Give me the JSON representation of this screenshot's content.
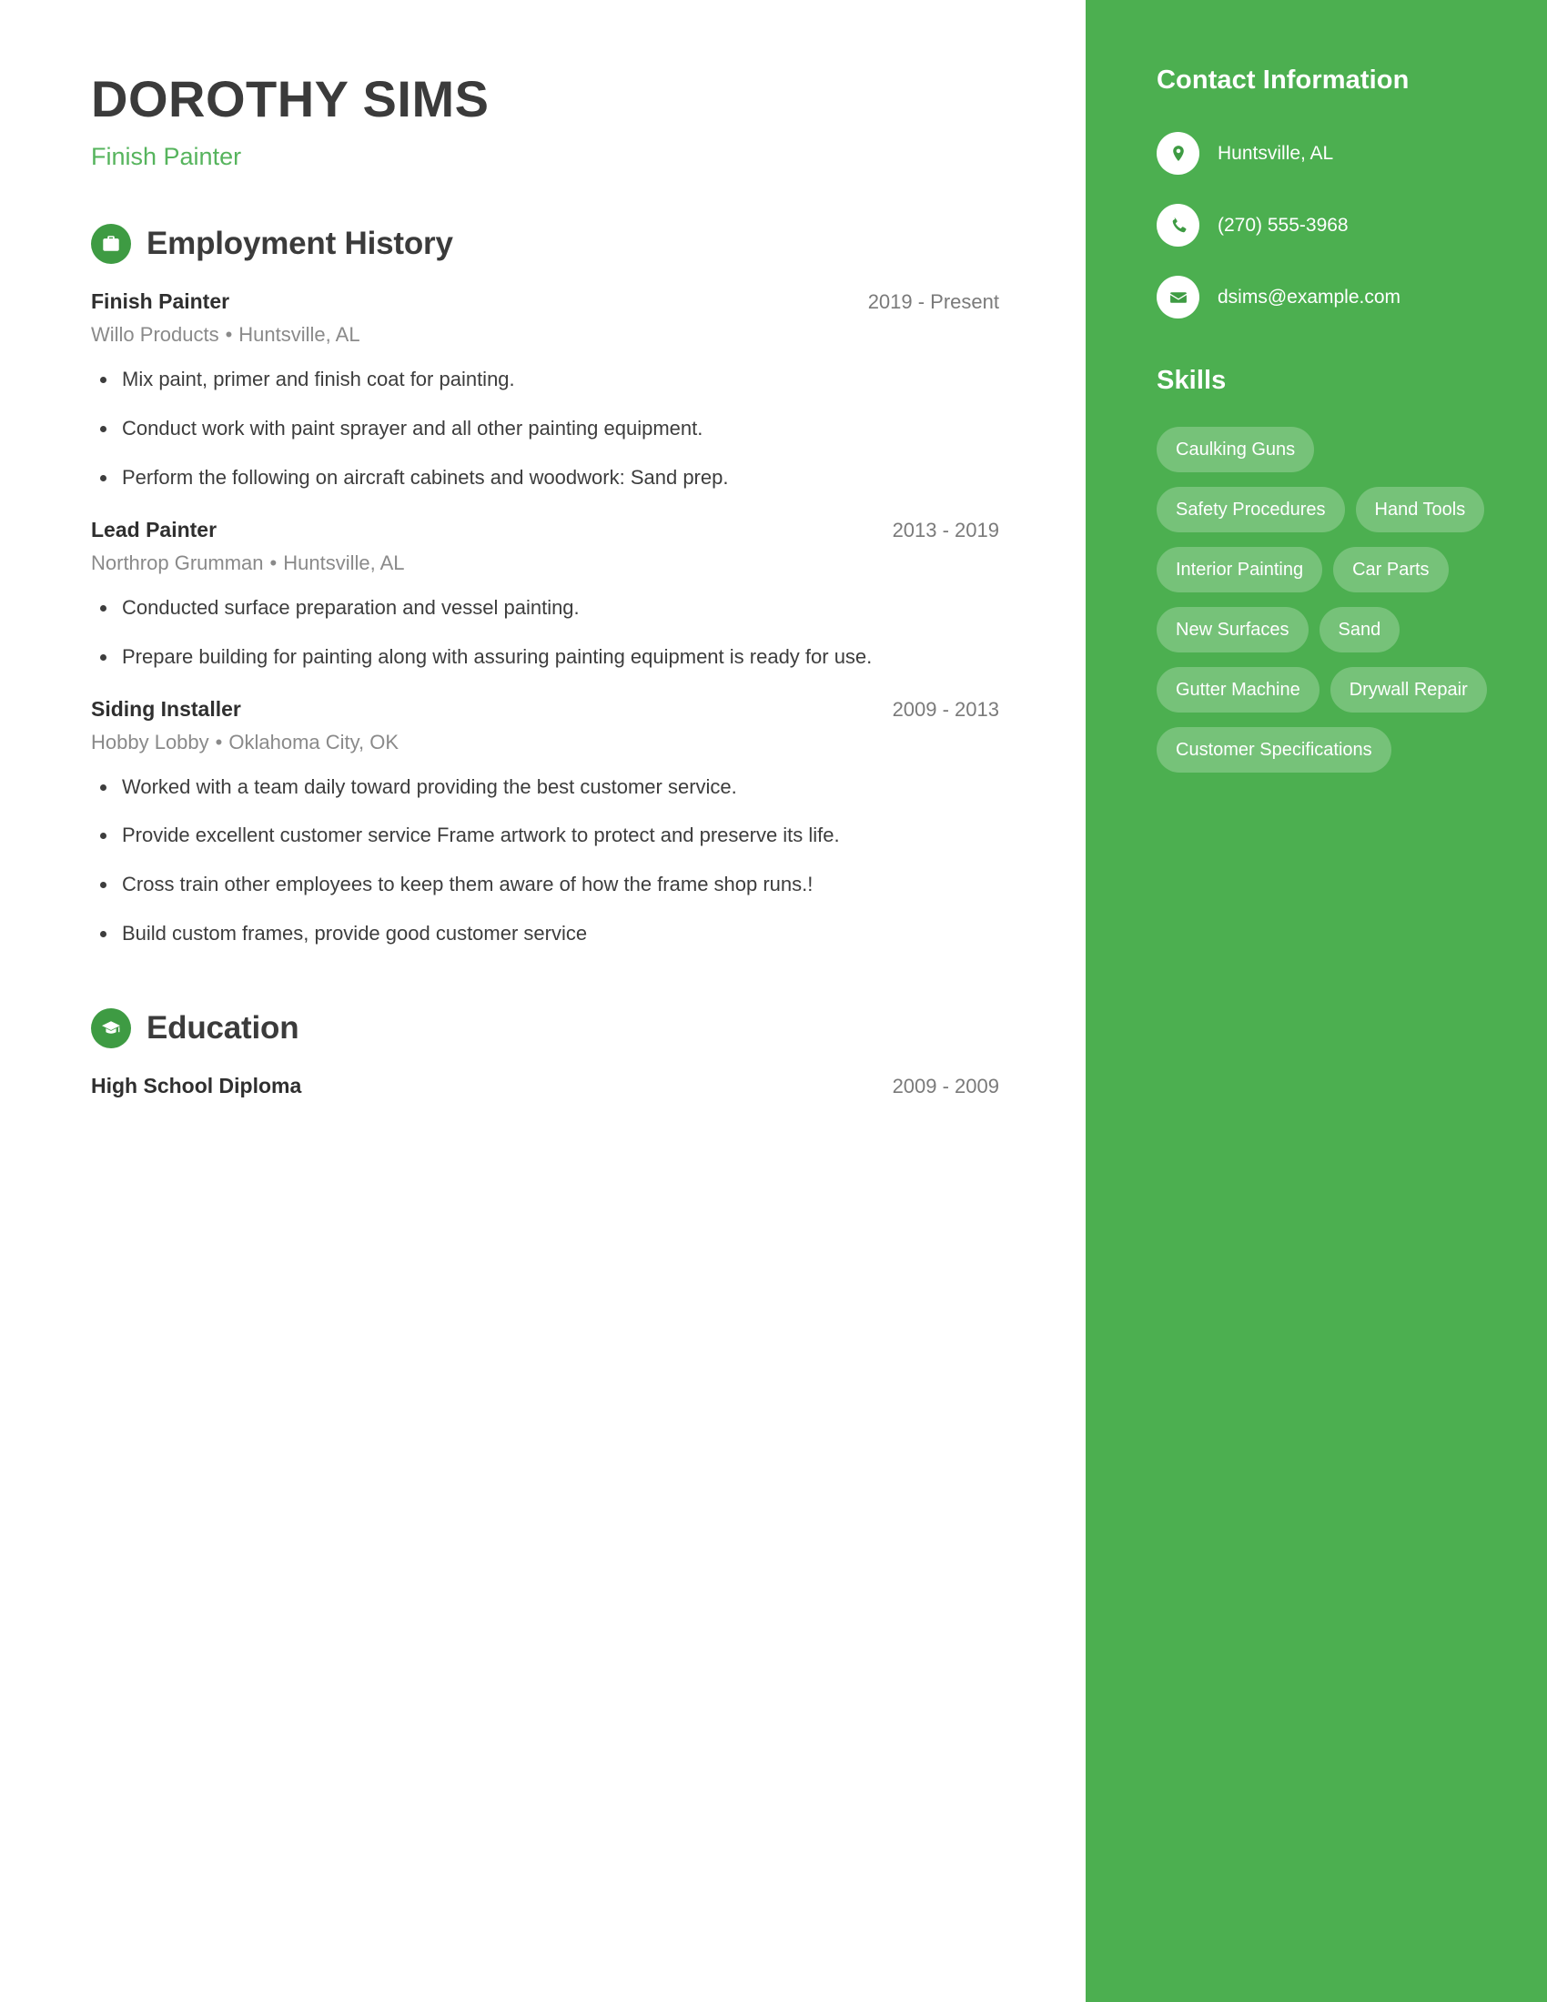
{
  "header": {
    "name": "DOROTHY SIMS",
    "job_title": "Finish Painter"
  },
  "theme": {
    "accent": "#4caf50",
    "accent_dark": "#3e9b43",
    "title_green": "#56b45d",
    "text_dark": "#3b3b3b",
    "text_muted": "#8a8a8a"
  },
  "sections": {
    "employment": {
      "title": "Employment History",
      "icon": "briefcase-icon",
      "entries": [
        {
          "role": "Finish Painter",
          "dates": "2019 - Present",
          "company": "Willo Products",
          "location": "Huntsville, AL",
          "bullets": [
            "Mix paint, primer and finish coat for painting.",
            "Conduct work with paint sprayer and all other painting equipment.",
            "Perform the following on aircraft cabinets and woodwork: Sand prep."
          ]
        },
        {
          "role": "Lead Painter",
          "dates": "2013 - 2019",
          "company": "Northrop Grumman",
          "location": "Huntsville, AL",
          "bullets": [
            "Conducted surface preparation and vessel painting.",
            "Prepare building for painting along with assuring painting equipment is ready for use."
          ]
        },
        {
          "role": "Siding Installer",
          "dates": "2009 - 2013",
          "company": "Hobby Lobby",
          "location": "Oklahoma City, OK",
          "bullets": [
            "Worked with a team daily toward providing the best customer service.",
            "Provide excellent customer service Frame artwork to protect and preserve its life.",
            "Cross train other employees to keep them aware of how the frame shop runs.!",
            "Build custom frames, provide good customer service"
          ]
        }
      ]
    },
    "education": {
      "title": "Education",
      "icon": "graduation-cap-icon",
      "entries": [
        {
          "degree": "High School Diploma",
          "dates": "2009 - 2009"
        }
      ]
    }
  },
  "sidebar": {
    "contact": {
      "title": "Contact Information",
      "items": [
        {
          "icon": "map-pin-icon",
          "value": "Huntsville, AL"
        },
        {
          "icon": "phone-icon",
          "value": "(270) 555-3968"
        },
        {
          "icon": "envelope-icon",
          "value": "dsims@example.com"
        }
      ]
    },
    "skills": {
      "title": "Skills",
      "items": [
        "Caulking Guns",
        "Safety Procedures",
        "Hand Tools",
        "Interior Painting",
        "Car Parts",
        "New Surfaces",
        "Sand",
        "Gutter Machine",
        "Drywall Repair",
        "Customer Specifications"
      ]
    }
  },
  "separators": {
    "bullet_dot": "•"
  }
}
